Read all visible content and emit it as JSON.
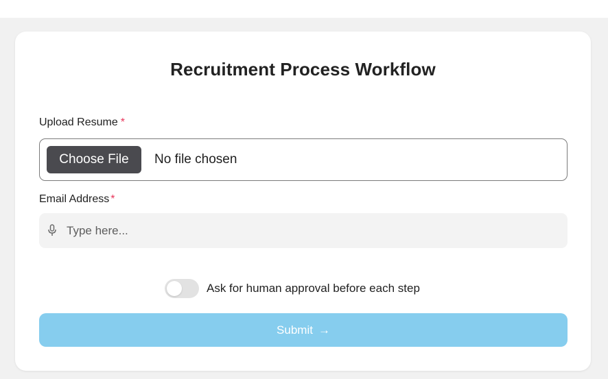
{
  "form": {
    "title": "Recruitment Process Workflow",
    "resume_label": "Upload Resume",
    "required_mark": "*",
    "choose_file_label": "Choose File",
    "file_status": "No file chosen",
    "email_label": "Email Address",
    "email_placeholder": "Type here...",
    "approval_toggle_label": "Ask for human approval before each step",
    "approval_toggle_on": false,
    "submit_label": "Submit",
    "submit_arrow": "→"
  },
  "icons": {
    "email_input_icon": "microphone-icon",
    "submit_icon": "arrow-right-icon"
  },
  "colors": {
    "required": "#e8355a",
    "submit_bg": "#86cdee",
    "choose_file_bg": "#4a4a4f"
  }
}
